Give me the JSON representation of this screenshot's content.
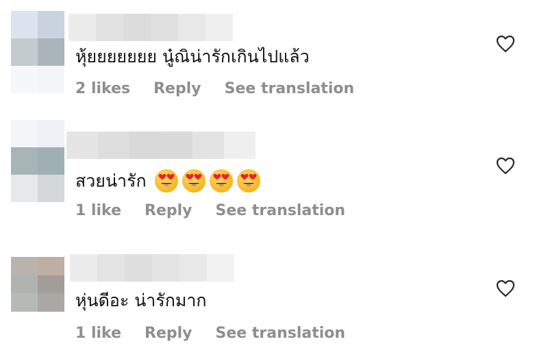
{
  "comments": [
    {
      "text": "หุ้ยยยยยยย นู๋ณิน่ารักเกินไปแล้ว",
      "likes": "2 likes",
      "reply": "Reply",
      "translate": "See translation",
      "emoji_count": 0,
      "avatar_colors": [
        "#dbe3ee",
        "#c8d3df",
        "#c3cbcf",
        "#a9b5b9",
        "#f6f7f9",
        "#f4f5f6"
      ],
      "username_colors": [
        "#ececec",
        "#e2e2e2",
        "#dcdcdc",
        "#e0e0e0",
        "#e8e8e8",
        "#f0f0f0"
      ]
    },
    {
      "text": "สวยน่ารัก",
      "likes": "1 like",
      "reply": "Reply",
      "translate": "See translation",
      "emoji_count": 4,
      "emoji_icon": "heart-eyes-emoji",
      "avatar_colors": [
        "#f3f5f8",
        "#eef1f5",
        "#a8b5b7",
        "#9fb0b3",
        "#e6e9ea",
        "#d4d8d8"
      ],
      "username_colors": [
        "#e5e5e5",
        "#dedede",
        "#d9d9d9",
        "#dadada",
        "#e3e3e3",
        "#efefef"
      ]
    },
    {
      "text": "หุ่นดีอะ น่ารักมาก",
      "likes": "1 like",
      "reply": "Reply",
      "translate": "See translation",
      "emoji_count": 0,
      "avatar_colors": [
        "#b9b3ae",
        "#c0aea4",
        "#b0b4b0",
        "#a29d98",
        "#b6bab7",
        "#a9a8a4"
      ],
      "username_colors": [
        "#ececec",
        "#e4e4e4",
        "#dedede",
        "#e4e4e4",
        "#e8e8e8",
        "#f2f2f2"
      ]
    }
  ],
  "icons": {
    "like": "heart-outline-icon"
  }
}
